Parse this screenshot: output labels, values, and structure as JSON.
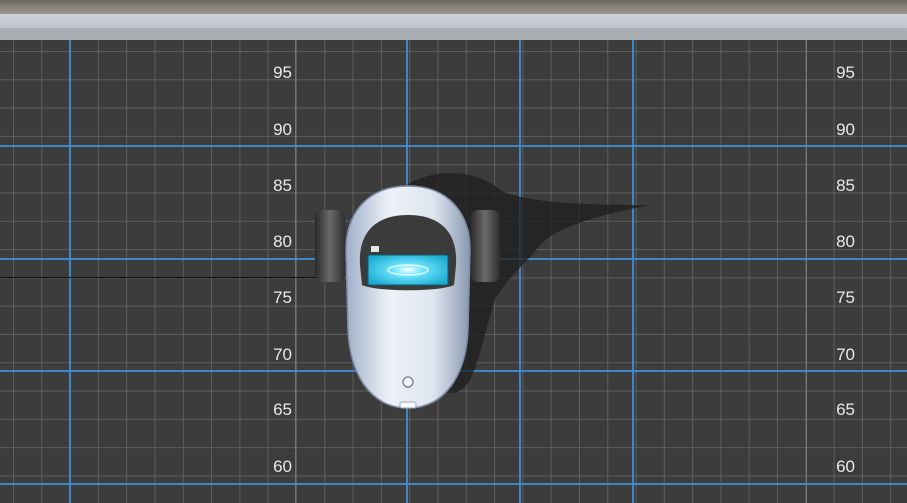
{
  "scene": {
    "left_tick_labels": [
      "95",
      "90",
      "85",
      "80",
      "75",
      "70",
      "65",
      "60"
    ],
    "right_tick_labels": [
      "95",
      "90",
      "85",
      "80",
      "75",
      "70",
      "65",
      "60"
    ],
    "grid_color": "#3d8fd6",
    "floor_color": "#3c3c3c",
    "robot_screen_color": "#27c9e8"
  }
}
